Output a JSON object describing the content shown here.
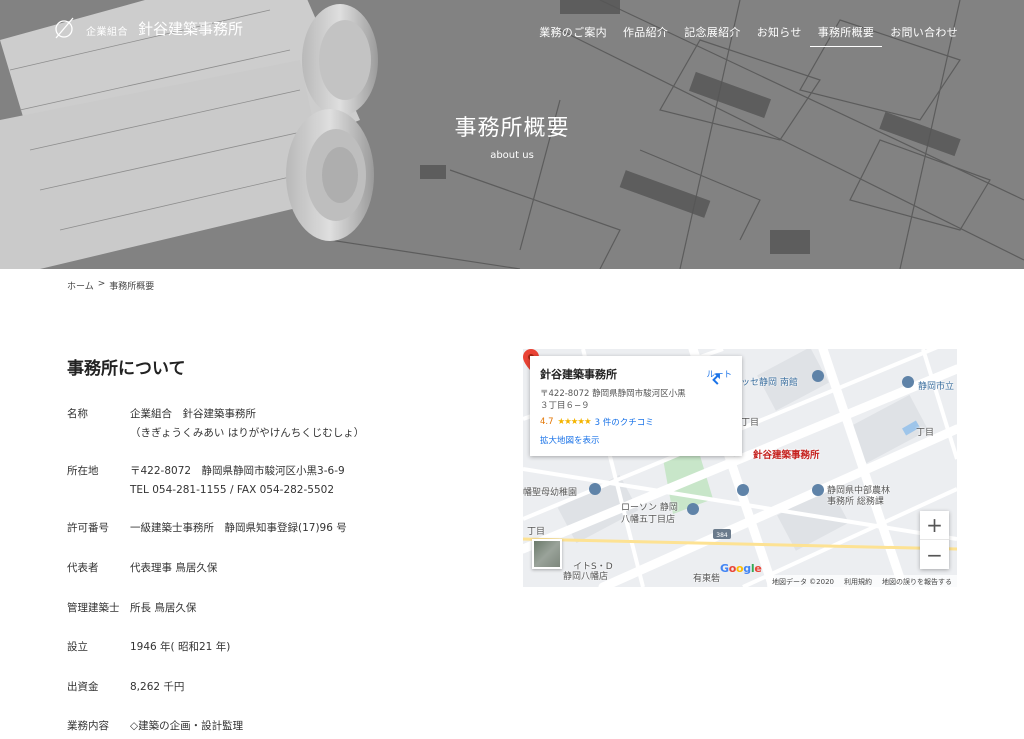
{
  "header": {
    "logo_sub": "企業組合",
    "logo_main": "針谷建築事務所",
    "nav": [
      {
        "label": "業務のご案内",
        "active": false
      },
      {
        "label": "作品紹介",
        "active": false
      },
      {
        "label": "記念展紹介",
        "active": false
      },
      {
        "label": "お知らせ",
        "active": false
      },
      {
        "label": "事務所概要",
        "active": true
      },
      {
        "label": "お問い合わせ",
        "active": false
      }
    ]
  },
  "hero": {
    "title": "事務所概要",
    "subtitle": "about us"
  },
  "breadcrumb": {
    "home": "ホーム",
    "separator": ">",
    "current": "事務所概要"
  },
  "about": {
    "title": "事務所について",
    "rows": [
      {
        "label": "名称",
        "lines": [
          "企業組合　針谷建築事務所",
          "（きぎょうくみあい はりがやけんちくじむしょ）"
        ]
      },
      {
        "label": "所在地",
        "lines": [
          "〒422-8072　静岡県静岡市駿河区小黒3-6-9",
          "TEL 054-281-1155 / FAX 054-282-5502"
        ]
      },
      {
        "label": "許可番号",
        "lines": [
          "一級建築士事務所　静岡県知事登録(17)96 号"
        ]
      },
      {
        "label": "代表者",
        "lines": [
          "代表理事 鳥居久保"
        ]
      },
      {
        "label": "管理建築士",
        "lines": [
          "所長 鳥居久保"
        ]
      },
      {
        "label": "設立",
        "lines": [
          "1946 年( 昭和21 年)"
        ]
      },
      {
        "label": "出資金",
        "lines": [
          "8,262 千円"
        ]
      },
      {
        "label": "業務内容",
        "lines": [
          "◇建築の企画・設計監理"
        ]
      }
    ]
  },
  "map": {
    "card_name": "針谷建築事務所",
    "card_address": "〒422-8072 静岡県静岡市駿河区小黒３丁目６−９",
    "rating": "4.7",
    "stars": "★★★★★",
    "reviews": "3 件のクチコミ",
    "enlarge_link": "拡大地図を表示",
    "route_label": "ルート",
    "marker_label": "針谷建築事務所",
    "places": [
      "ッセ静岡 南館",
      "静岡市立",
      "丁目",
      "丁目",
      "静岡県中部農林",
      "事務所 総務課",
      "ローソン 静岡",
      "八幡五丁目店",
      "幡聖母幼稚園",
      "丁目",
      "イトS・D",
      "静岡八幡店",
      "有東砦"
    ],
    "road_number": "384",
    "google": "Google",
    "footer": [
      "地図データ ©2020",
      "利用規約",
      "地図の誤りを報告する"
    ],
    "zoom_in": "+",
    "zoom_out": "−",
    "colors": {
      "marker": "#ea4335",
      "link": "#1a73e8",
      "rating": "#e37400",
      "stars": "#f4b400"
    }
  }
}
